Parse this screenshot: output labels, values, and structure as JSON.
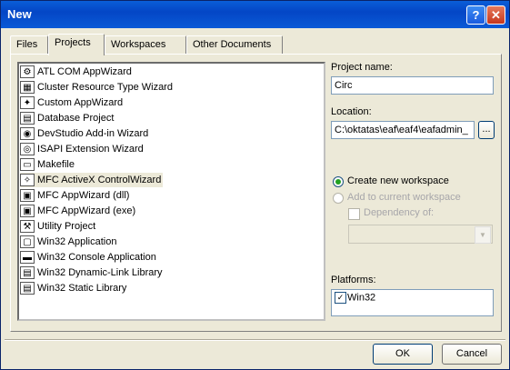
{
  "window": {
    "title": "New",
    "help_glyph": "?",
    "close_glyph": "✕"
  },
  "tabs": [
    {
      "label": "Files"
    },
    {
      "label": "Projects"
    },
    {
      "label": "Workspaces"
    },
    {
      "label": "Other Documents"
    }
  ],
  "projects": [
    {
      "label": "ATL COM AppWizard",
      "icon": "atl-icon",
      "glyph": "⚙"
    },
    {
      "label": "Cluster Resource Type Wizard",
      "icon": "cluster-icon",
      "glyph": "▦"
    },
    {
      "label": "Custom AppWizard",
      "icon": "custom-wizard-icon",
      "glyph": "✦"
    },
    {
      "label": "Database Project",
      "icon": "database-icon",
      "glyph": "▤"
    },
    {
      "label": "DevStudio Add-in Wizard",
      "icon": "addin-icon",
      "glyph": "◉"
    },
    {
      "label": "ISAPI Extension Wizard",
      "icon": "isapi-icon",
      "glyph": "◎"
    },
    {
      "label": "Makefile",
      "icon": "makefile-icon",
      "glyph": "▭"
    },
    {
      "label": "MFC ActiveX ControlWizard",
      "icon": "activex-icon",
      "glyph": "✧"
    },
    {
      "label": "MFC AppWizard (dll)",
      "icon": "mfc-dll-icon",
      "glyph": "▣"
    },
    {
      "label": "MFC AppWizard (exe)",
      "icon": "mfc-exe-icon",
      "glyph": "▣"
    },
    {
      "label": "Utility Project",
      "icon": "utility-icon",
      "glyph": "⚒"
    },
    {
      "label": "Win32 Application",
      "icon": "win32-app-icon",
      "glyph": "▢"
    },
    {
      "label": "Win32 Console Application",
      "icon": "console-icon",
      "glyph": "▬"
    },
    {
      "label": "Win32 Dynamic-Link Library",
      "icon": "dll-icon",
      "glyph": "▤"
    },
    {
      "label": "Win32 Static Library",
      "icon": "static-lib-icon",
      "glyph": "▤"
    }
  ],
  "form": {
    "project_name_label": "Project name:",
    "project_name_value": "Circ",
    "location_label": "Location:",
    "location_value": "C:\\oktatas\\eaf\\eaf4\\eafadmin_",
    "browse_label": "...",
    "create_new_label": "Create new workspace",
    "add_current_label": "Add to current workspace",
    "dependency_label": "Dependency of:",
    "platforms_label": "Platforms:",
    "platform_item": "Win32",
    "check_glyph": "✓",
    "combo_arrow": "▼"
  },
  "buttons": {
    "ok": "OK",
    "cancel": "Cancel"
  }
}
